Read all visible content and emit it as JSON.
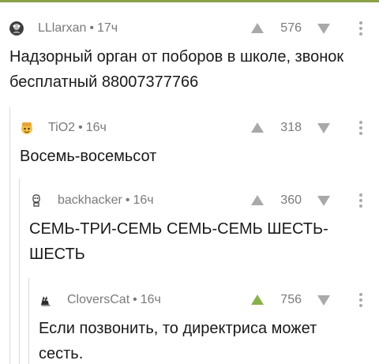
{
  "colors": {
    "accent": "#8ab04a",
    "muted": "#a9a9a9",
    "topbar": "#8aa14a"
  },
  "comments": [
    {
      "author": "LLlarxan",
      "time": "17ч",
      "score": "576",
      "text": "Надзорный орган от поборов в школе, звонок бесплатный 88007377766",
      "avatar_icon": "user-avatar-icon"
    },
    {
      "author": "TiO2",
      "time": "16ч",
      "score": "318",
      "text": "Восемь-восемьсот",
      "avatar_icon": "user-avatar-icon"
    },
    {
      "author": "backhacker",
      "time": "16ч",
      "score": "360",
      "text": "СЕМЬ-ТРИ-СЕМЬ СЕМЬ-СЕМЬ ШЕСТЬ-ШЕСТЬ",
      "avatar_icon": "user-avatar-icon"
    },
    {
      "author": "CloversCat",
      "time": "16ч",
      "score": "756",
      "text": "Если позвонить, то директриса может сесть.",
      "avatar_icon": "user-avatar-icon",
      "upvoted": true
    }
  ]
}
